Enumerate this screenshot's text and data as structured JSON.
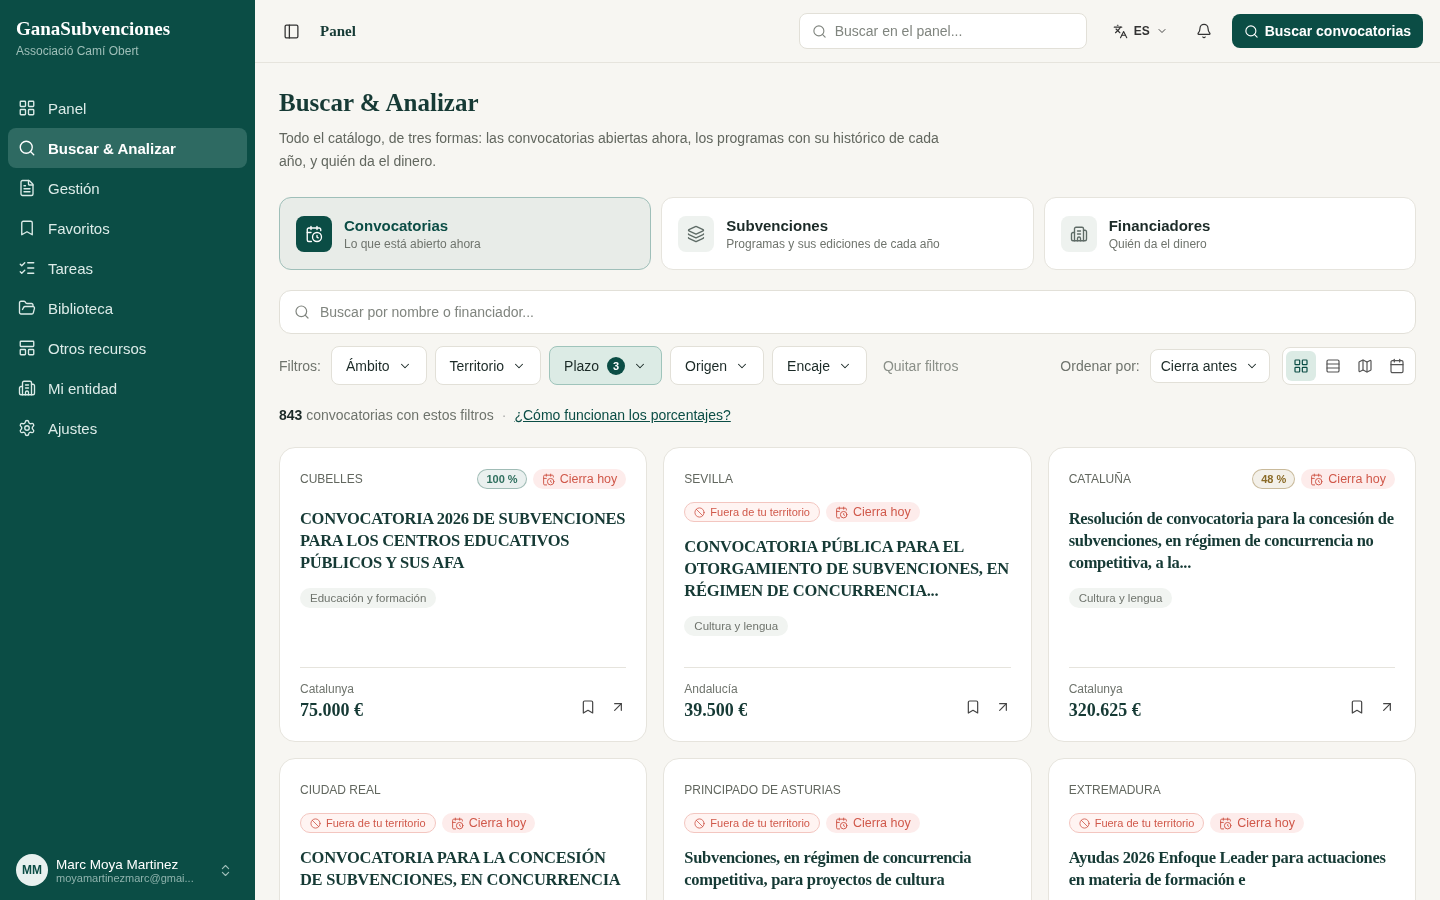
{
  "sidebar": {
    "brand": "GanaSubvenciones",
    "org": "Associació Camí Obert",
    "items": [
      {
        "label": "Panel",
        "selected": false
      },
      {
        "label": "Buscar & Analizar",
        "selected": true
      },
      {
        "label": "Gestión",
        "selected": false
      },
      {
        "label": "Favoritos",
        "selected": false
      },
      {
        "label": "Tareas",
        "selected": false
      },
      {
        "label": "Biblioteca",
        "selected": false
      },
      {
        "label": "Otros recursos",
        "selected": false
      },
      {
        "label": "Mi entidad",
        "selected": false
      },
      {
        "label": "Ajustes",
        "selected": false
      }
    ],
    "user": {
      "initials": "MM",
      "name": "Marc Moya Martinez",
      "email": "moyamartinezmarc@gmai..."
    }
  },
  "topbar": {
    "title": "Panel",
    "search_placeholder": "Buscar en el panel...",
    "language": "ES",
    "action": "Buscar convocatorias"
  },
  "page": {
    "title": "Buscar & Analizar",
    "description": "Todo el catálogo, de tres formas: las convocatorias abiertas ahora, los programas con su histórico de cada año, y quién da el dinero."
  },
  "modes": [
    {
      "title": "Convocatorias",
      "subtitle": "Lo que está abierto ahora",
      "selected": true
    },
    {
      "title": "Subvenciones",
      "subtitle": "Programas y sus ediciones de cada año",
      "selected": false
    },
    {
      "title": "Financiadores",
      "subtitle": "Quién da el dinero",
      "selected": false
    }
  ],
  "search": {
    "placeholder": "Buscar por nombre o financiador..."
  },
  "filters": {
    "label": "Filtros:",
    "items": [
      {
        "label": "Ámbito",
        "active": false
      },
      {
        "label": "Territorio",
        "active": false
      },
      {
        "label": "Plazo",
        "count": "3",
        "active": true
      },
      {
        "label": "Origen",
        "active": false
      },
      {
        "label": "Encaje",
        "active": false
      }
    ],
    "clear": "Quitar filtros",
    "sort_label": "Ordenar por:",
    "sort_value": "Cierra antes",
    "views": [
      {
        "selected": true
      },
      {
        "selected": false
      },
      {
        "selected": false
      },
      {
        "selected": false
      }
    ]
  },
  "results": {
    "count": "843",
    "text": "convocatorias con estos filtros",
    "separator": "·",
    "help_link": "¿Cómo funcionan los porcentajes?"
  },
  "cards": [
    {
      "region": "CUBELLES",
      "score": {
        "text": "100 %",
        "color": "#2f6f5e"
      },
      "badges": [
        {
          "kind": "closing",
          "text": "Cierra hoy"
        }
      ],
      "title": "CONVOCATORIA 2026 DE SUBVENCIONES PARA LOS CENTROS EDUCATIVOS PÚBLICOS Y SUS AFA",
      "tag": "Educación y formación",
      "territory": "Catalunya",
      "amount": "75.000 €"
    },
    {
      "region": "SEVILLA",
      "badges": [
        {
          "kind": "outside",
          "text": "Fuera de tu territorio"
        },
        {
          "kind": "closing",
          "text": "Cierra hoy"
        }
      ],
      "title": "CONVOCATORIA PÚBLICA PARA EL OTORGAMIENTO DE SUBVENCIONES, EN RÉGIMEN DE CONCURRENCIA...",
      "tag": "Cultura y lengua",
      "territory": "Andalucía",
      "amount": "39.500 €"
    },
    {
      "region": "CATALUÑA",
      "score": {
        "text": "48 %",
        "color": "#8a6a26"
      },
      "badges": [
        {
          "kind": "closing",
          "text": "Cierra hoy"
        }
      ],
      "title": "Resolución de convocatoria para la concesión de subvenciones, en régimen de concurrencia no competitiva, a la...",
      "tag": "Cultura y lengua",
      "territory": "Catalunya",
      "amount": "320.625 €"
    },
    {
      "region": "CIUDAD REAL",
      "badges": [
        {
          "kind": "outside",
          "text": "Fuera de tu territorio"
        },
        {
          "kind": "closing",
          "text": "Cierra hoy"
        }
      ],
      "title": "CONVOCATORIA PARA LA CONCESIÓN DE SUBVENCIONES, EN CONCURRENCIA"
    },
    {
      "region": "PRINCIPADO DE ASTURIAS",
      "badges": [
        {
          "kind": "outside",
          "text": "Fuera de tu territorio"
        },
        {
          "kind": "closing",
          "text": "Cierra hoy"
        }
      ],
      "title": "Subvenciones, en régimen de concurrencia competitiva, para proyectos de cultura"
    },
    {
      "region": "EXTREMADURA",
      "badges": [
        {
          "kind": "outside",
          "text": "Fuera de tu territorio"
        },
        {
          "kind": "closing",
          "text": "Cierra hoy"
        }
      ],
      "title": "Ayudas 2026 Enfoque Leader para actuaciones en materia de formación e"
    }
  ]
}
